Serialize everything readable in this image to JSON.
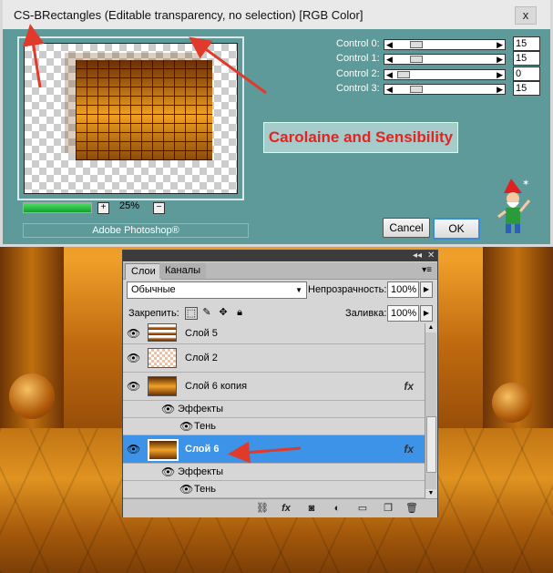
{
  "dialog": {
    "title": "CS-BRectangles (Editable transparency, no selection) [RGB Color]",
    "close_label": "x",
    "zoom": "25%",
    "zoom_plus": "+",
    "zoom_minus": "−",
    "progress": 1.0,
    "brand": "Adobe Photoshop®",
    "banner": "Carolaine and Sensibility",
    "controls": [
      {
        "label": "Control 0:",
        "value": "15",
        "pos": 0.15
      },
      {
        "label": "Control 1:",
        "value": "15",
        "pos": 0.15
      },
      {
        "label": "Control 2:",
        "value": "0",
        "pos": 0.0
      },
      {
        "label": "Control 3:",
        "value": "15",
        "pos": 0.15
      }
    ],
    "cancel_label": "Cancel",
    "ok_label": "OK"
  },
  "layers_panel": {
    "tabs": [
      "Слои",
      "Каналы"
    ],
    "blend_mode": "Обычные",
    "opacity_label": "Непрозрачность:",
    "opacity_value": "100%",
    "lock_label": "Закрепить:",
    "fill_label": "Заливка:",
    "fill_value": "100%",
    "layers": [
      {
        "name": "Слой 5",
        "fx": ""
      },
      {
        "name": "Слой 2",
        "fx": ""
      },
      {
        "name": "Слой 6 копия",
        "fx": "fx"
      },
      {
        "name": "Эффекты",
        "fx": ""
      },
      {
        "name": "Тень",
        "fx": ""
      },
      {
        "name": "Слой 6",
        "fx": "fx"
      },
      {
        "name": "Эффекты",
        "fx": ""
      },
      {
        "name": "Тень",
        "fx": ""
      }
    ]
  },
  "colors": {
    "dialog_bg": "#5f9a9a",
    "selection": "#3c93e8",
    "banner_text": "#e8221f",
    "arrow": "#e03a2a"
  }
}
